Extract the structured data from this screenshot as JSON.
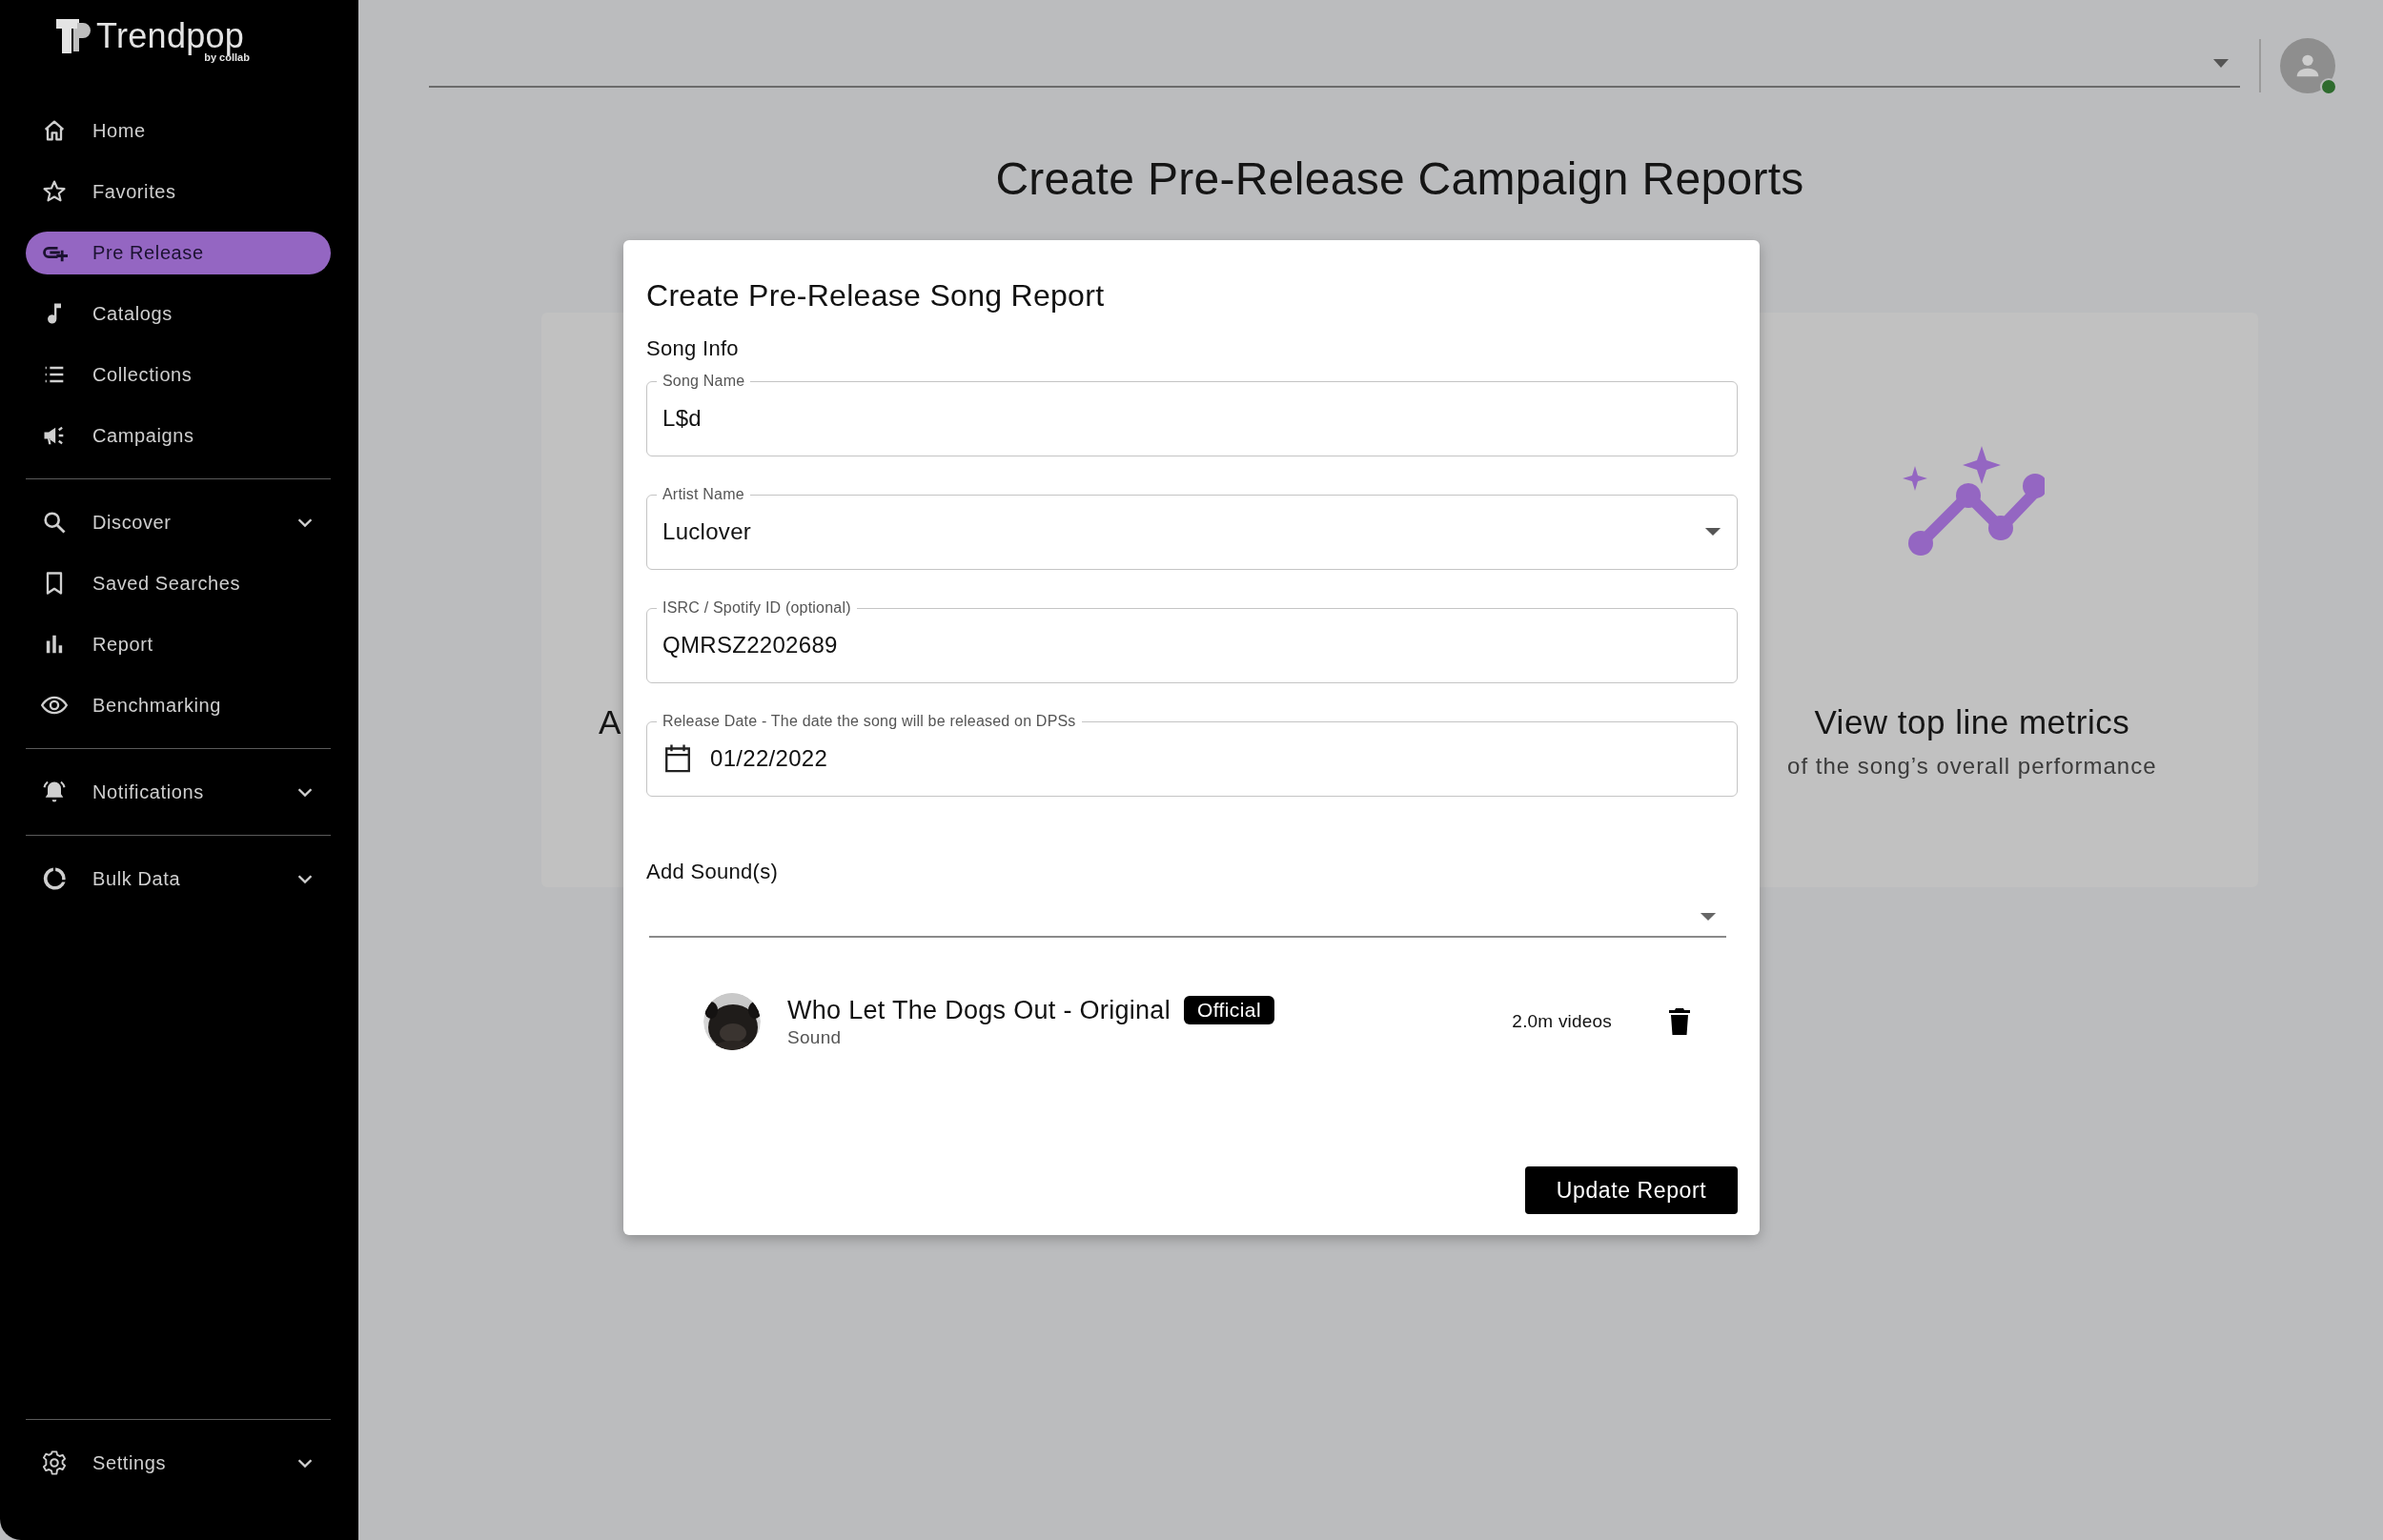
{
  "brand": {
    "name": "Trendpop",
    "tagline": "by collab"
  },
  "sidebar": {
    "groups": [
      {
        "items": [
          {
            "label": "Home",
            "selected": false,
            "has_submenu": false
          },
          {
            "label": "Favorites",
            "selected": false,
            "has_submenu": false
          },
          {
            "label": "Pre Release",
            "selected": true,
            "has_submenu": false
          },
          {
            "label": "Catalogs",
            "selected": false,
            "has_submenu": false
          },
          {
            "label": "Collections",
            "selected": false,
            "has_submenu": false
          },
          {
            "label": "Campaigns",
            "selected": false,
            "has_submenu": false
          }
        ]
      },
      {
        "items": [
          {
            "label": "Discover",
            "selected": false,
            "has_submenu": true
          },
          {
            "label": "Saved Searches",
            "selected": false,
            "has_submenu": false
          },
          {
            "label": "Report",
            "selected": false,
            "has_submenu": false
          },
          {
            "label": "Benchmarking",
            "selected": false,
            "has_submenu": false
          }
        ]
      },
      {
        "items": [
          {
            "label": "Notifications",
            "selected": false,
            "has_submenu": true
          }
        ]
      },
      {
        "items": [
          {
            "label": "Bulk Data",
            "selected": false,
            "has_submenu": true
          }
        ]
      },
      {
        "items": [
          {
            "label": "Settings",
            "selected": false,
            "has_submenu": true
          }
        ]
      }
    ]
  },
  "top_bar": {
    "user_online": true
  },
  "hero": {
    "title": "Create Pre-Release Campaign Reports"
  },
  "feature_cards": [
    {
      "title": "A"
    },
    {
      "title": "View top line metrics",
      "subtitle": "of the song’s overall performance"
    }
  ],
  "modal": {
    "title": "Create Pre-Release Song Report",
    "section": "Song Info",
    "fields": [
      {
        "kind": "text",
        "label": "Song Name",
        "value": "L$d"
      },
      {
        "kind": "select",
        "label": "Artist Name",
        "value": "Luclover"
      },
      {
        "kind": "text",
        "label": "ISRC / Spotify ID (optional)",
        "value": "QMRSZ2202689"
      },
      {
        "kind": "date",
        "label": "Release Date - The date the song will be released on DPSs",
        "value": "01/22/2022"
      }
    ],
    "sounds_label": "Add Sound(s)",
    "sounds": [
      {
        "title": "Who Let The Dogs Out - Original",
        "badge": "Official",
        "type": "Sound",
        "videos": "2.0m videos"
      }
    ],
    "submit": "Update Report"
  }
}
